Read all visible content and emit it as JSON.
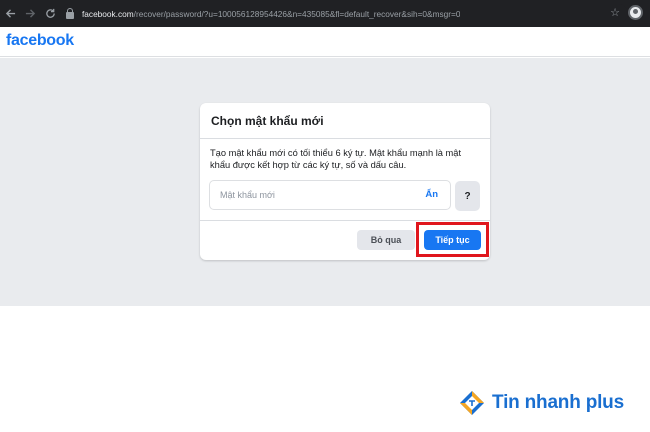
{
  "browser": {
    "url_host": "facebook.com",
    "url_path": "/recover/password/?u=100056128954426&n=435085&fl=default_recover&sih=0&msgr=0",
    "back_icon": "arrow-left-icon",
    "forward_icon": "arrow-right-icon",
    "reload_icon": "reload-icon",
    "star_icon": "star-icon"
  },
  "header": {
    "logo": "facebook"
  },
  "dialog": {
    "title": "Chọn mật khẩu mới",
    "description": "Tạo mật khẩu mới có tối thiểu 6 ký tự. Mật khẩu mạnh là mật khẩu được kết hợp từ các ký tự, số và dấu câu.",
    "password_placeholder": "Mật khẩu mới",
    "password_value": "",
    "hide_label": "Ẩn",
    "help_label": "?",
    "skip_label": "Bỏ qua",
    "continue_label": "Tiếp tục"
  },
  "watermark": {
    "text": "Tin nhanh plus"
  },
  "colors": {
    "brand": "#1877f2",
    "highlight": "#e0161d",
    "background": "#e9ebee"
  }
}
